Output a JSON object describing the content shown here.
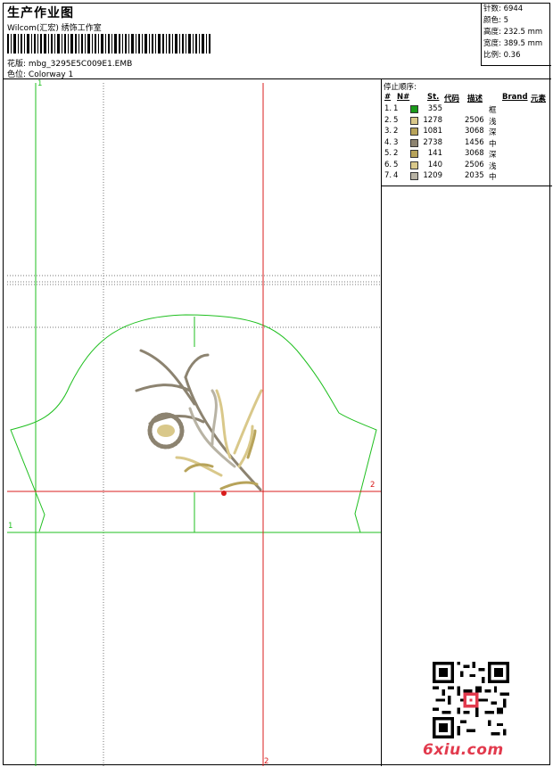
{
  "header": {
    "title": "生产作业图",
    "company": "Wilcom(汇宏) 绣饰工作室",
    "design_label": "花版:",
    "design_value": "mbg_3295E5C009E1.EMB",
    "colorway_label": "色位:",
    "colorway_value": "Colorway 1"
  },
  "info": {
    "stitches": "针数: 6944",
    "colors": "颜色: 5",
    "height": "高度: 232.5 mm",
    "width": "宽度: 389.5 mm",
    "scale": "比例: 0.36"
  },
  "stop_sequence": {
    "title": "停止顺序:",
    "headers": [
      "#",
      "N#",
      "St.",
      "代码",
      "描述",
      "Brand",
      "元素"
    ],
    "rows": [
      {
        "idx": "1.",
        "n": "1",
        "color": "#1a9a1a",
        "st": "355",
        "code": "",
        "desc": "框"
      },
      {
        "idx": "2.",
        "n": "5",
        "color": "#d9c88a",
        "st": "1278",
        "code": "2506",
        "desc": "浅"
      },
      {
        "idx": "3.",
        "n": "2",
        "color": "#b7a35a",
        "st": "1081",
        "code": "3068",
        "desc": "深"
      },
      {
        "idx": "4.",
        "n": "3",
        "color": "#8c8370",
        "st": "2738",
        "code": "1456",
        "desc": "中"
      },
      {
        "idx": "5.",
        "n": "2",
        "color": "#b7a35a",
        "st": "141",
        "code": "3068",
        "desc": "深"
      },
      {
        "idx": "6.",
        "n": "5",
        "color": "#d9c88a",
        "st": "140",
        "code": "2506",
        "desc": "浅"
      },
      {
        "idx": "7.",
        "n": "4",
        "color": "#b8b3a4",
        "st": "1209",
        "code": "2035",
        "desc": "中"
      }
    ]
  },
  "markers": {
    "green_top": "1",
    "green_left": "1",
    "red_right": "2",
    "red_bottom": "2"
  },
  "watermark": {
    "site": "6xiu.com"
  },
  "colors": {
    "frame_green": "#1fbf1f",
    "guide_red": "#d81c1c",
    "brand_red": "#e23a4d"
  }
}
